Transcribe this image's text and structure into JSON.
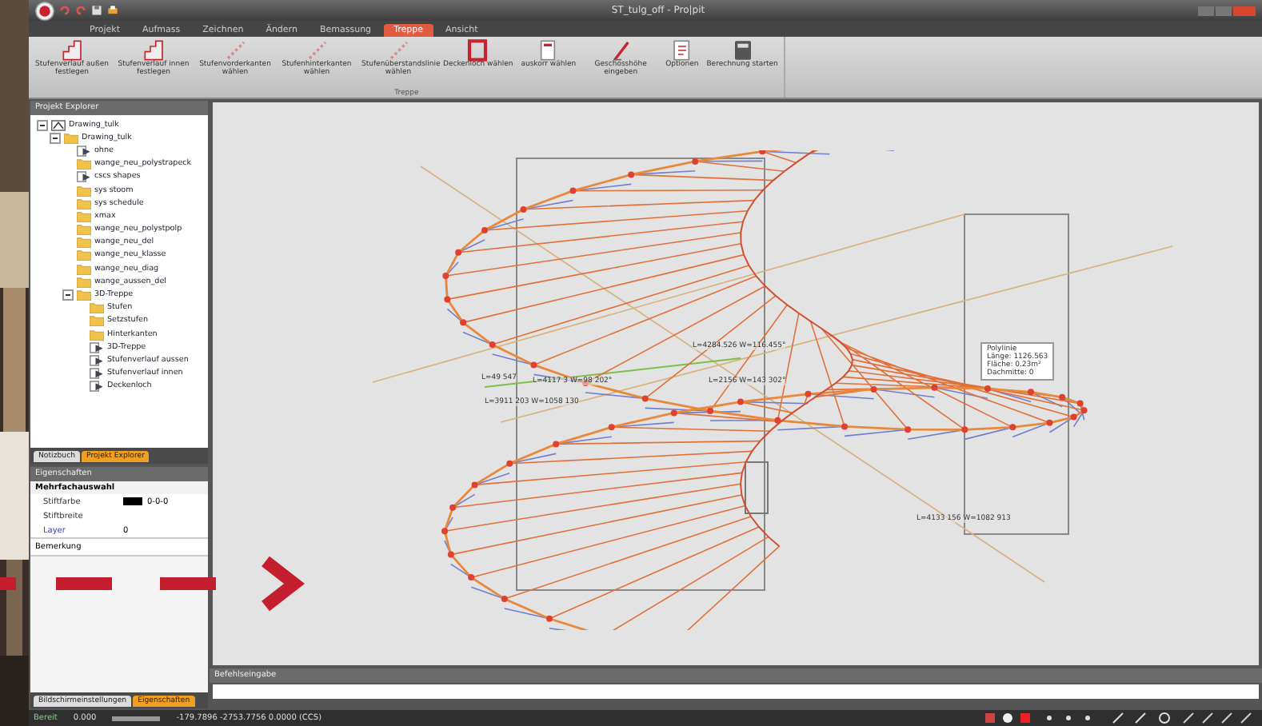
{
  "window": {
    "title": "ST_tulg_off - Pro|pit"
  },
  "tabs": [
    {
      "label": "Projekt",
      "selected": false
    },
    {
      "label": "Aufmass",
      "selected": false
    },
    {
      "label": "Zeichnen",
      "selected": false
    },
    {
      "label": "Ändern",
      "selected": false
    },
    {
      "label": "Bemassung",
      "selected": false
    },
    {
      "label": "Treppe",
      "selected": true
    },
    {
      "label": "Ansicht",
      "selected": false
    }
  ],
  "ribbon": {
    "group": "Treppe",
    "buttons": [
      {
        "label": "Stufenverlauf außen festlegen"
      },
      {
        "label": "Stufenverlauf innen festlegen"
      },
      {
        "label": "Stufenvorderkanten wählen"
      },
      {
        "label": "Stufenhinterkanten wählen"
      },
      {
        "label": "Stufenüberstandslinie wählen"
      },
      {
        "label": "Deckenloch wählen"
      },
      {
        "label": "auskorr wählen"
      },
      {
        "label": "Geschosshöhe eingeben"
      },
      {
        "label": "Optionen"
      },
      {
        "label": "Berechnung starten"
      }
    ]
  },
  "explorer": {
    "title": "Projekt Explorer",
    "tree": [
      {
        "label": "Drawing_tulk",
        "kind": "drawing",
        "expanded": true,
        "children": [
          {
            "label": "Drawing_tulk",
            "kind": "folder",
            "expanded": true,
            "children": [
              {
                "label": "ohne",
                "kind": "layer"
              },
              {
                "label": "wange_neu_polystrapeck",
                "kind": "folder"
              },
              {
                "label": "cscs shapes",
                "kind": "layer"
              },
              {
                "label": "sys stoom",
                "kind": "folder"
              },
              {
                "label": "sys schedule",
                "kind": "folder"
              },
              {
                "label": "xmax",
                "kind": "folder"
              },
              {
                "label": "wange_neu_polystpolp",
                "kind": "folder"
              },
              {
                "label": "wange_neu_del",
                "kind": "folder"
              },
              {
                "label": "wange_neu_klasse",
                "kind": "folder"
              },
              {
                "label": "wange_neu_diag",
                "kind": "folder"
              },
              {
                "label": "wange_aussen_del",
                "kind": "folder"
              },
              {
                "label": "3D-Treppe",
                "kind": "folder",
                "expanded": true,
                "children": [
                  {
                    "label": "Stufen",
                    "kind": "folder"
                  },
                  {
                    "label": "Setzstufen",
                    "kind": "folder"
                  },
                  {
                    "label": "Hinterkanten",
                    "kind": "folder"
                  },
                  {
                    "label": "3D-Treppe",
                    "kind": "layer"
                  },
                  {
                    "label": "Stufenverlauf aussen",
                    "kind": "layer"
                  },
                  {
                    "label": "Stufenverlauf innen",
                    "kind": "layer"
                  },
                  {
                    "label": "Deckenloch",
                    "kind": "layer"
                  }
                ]
              }
            ]
          }
        ]
      }
    ],
    "tabs": [
      {
        "label": "Notizbuch",
        "selected": false
      },
      {
        "label": "Projekt Explorer",
        "selected": true
      }
    ]
  },
  "properties": {
    "title": "Eigenschaften",
    "section": "Mehrfachauswahl",
    "rows": [
      {
        "name": "Stiftfarbe",
        "value": "0-0-0",
        "kind": "color"
      },
      {
        "name": "Stiftbreite",
        "kind": "text"
      },
      {
        "name": "Layer",
        "value": "0",
        "link": true,
        "kind": "text"
      }
    ],
    "note": "Bemerkung",
    "tabs": [
      {
        "label": "Bildschirmeinstellungen",
        "selected": false
      },
      {
        "label": "Eigenschaften",
        "selected": true
      }
    ]
  },
  "canvas": {
    "labels": [
      "L=4284.526 W=116.455°",
      "L=3911 203 W=1058 130",
      "L=4117 3 W=98 202°",
      "L=49 547",
      "L=2156 W=143 302°",
      "L=4133 156 W=1082 913"
    ],
    "tooltip": [
      "Polylinie",
      "Länge: 1126.563",
      "Fläche: 0.23m²",
      "Dachmitte: 0"
    ]
  },
  "command": {
    "title": "Befehlseingabe"
  },
  "status_bar": {
    "ready": "Bereit",
    "scale": "0.000",
    "progress": {
      "level": 1
    },
    "coords": "-179.7896  -2753.7756  0.0000 (CCS)"
  }
}
